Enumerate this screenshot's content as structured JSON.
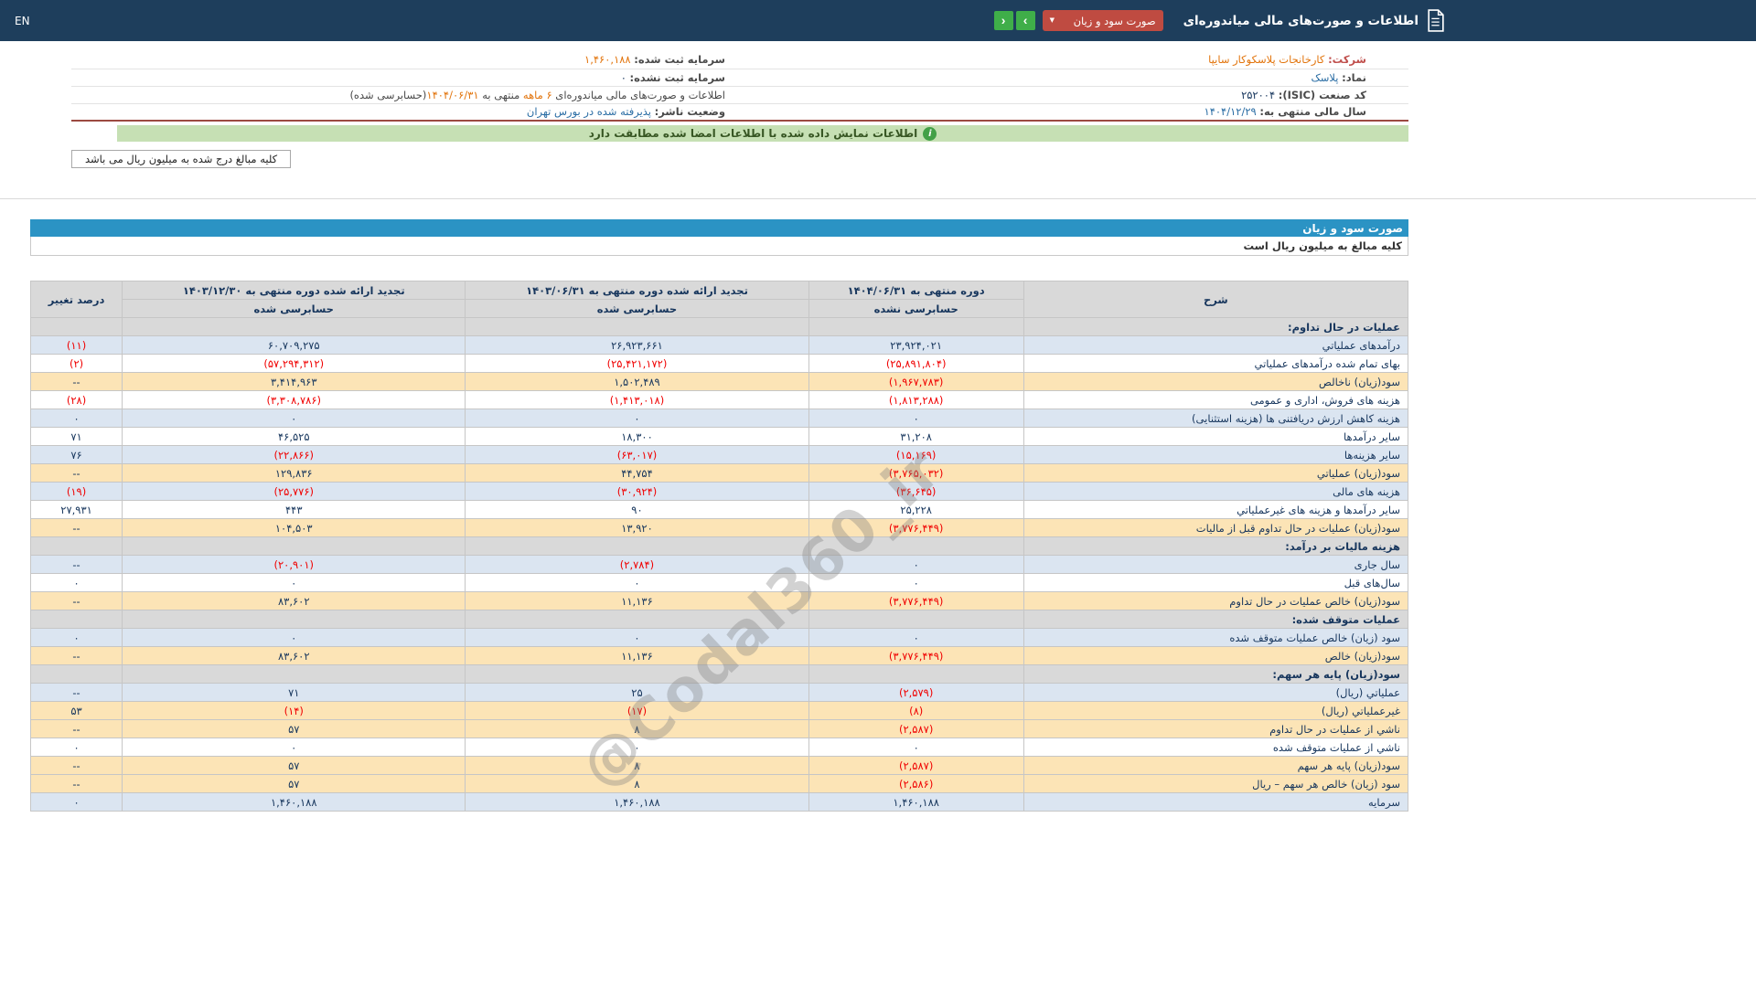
{
  "header": {
    "title": "اطلاعات و صورت‌های مالی میاندوره‌ای",
    "dropdown_value": "صورت سود و زیان",
    "next_label": "›",
    "prev_label": "‹",
    "en_label": "EN"
  },
  "company": {
    "name_label": "شرکت:",
    "name_value": "کارخانجات پلاسکوکار سایپا",
    "symbol_label": "نماد:",
    "symbol_value": "پلاسک",
    "isic_label": "کد صنعت (ISIC):",
    "isic_value": "۲۵۲۰۰۴",
    "fiscal_label": "سال مالی منتهی به:",
    "fiscal_value": "۱۴۰۴/۱۲/۲۹",
    "registered_capital_label": "سرمایه ثبت شده:",
    "registered_capital_value": "۱,۴۶۰,۱۸۸",
    "unregistered_capital_label": "سرمایه ثبت نشده:",
    "unregistered_capital_value": "۰",
    "period_info": {
      "p1": "اطلاعات و صورت‌های مالی میاندوره‌ای ",
      "p2": "۶ ماهه",
      "p3": " منتهی به ",
      "p4": "۱۴۰۴/۰۶/۳۱",
      "p5": "(حسابرسی شده)"
    },
    "issuer_status_label": "وضعیت ناشر:",
    "issuer_status_value": "پذیرفته شده در بورس تهران"
  },
  "notice": "اطلاعات نمایش داده شده با اطلاعات امضا شده مطابقت دارد",
  "amounts_note": "کلیه مبالغ درج شده به میلیون ریال می باشد",
  "watermark": "@Codal360_ir",
  "statement": {
    "title": "صورت سود و زیان",
    "unit_note": "کلیه مبالغ به میلیون ریال است",
    "table": {
      "desc_header": "شرح",
      "change_header": "درصد تغییر",
      "periods": [
        {
          "title": "دوره منتهی به ۱۴۰۴/۰۶/۳۱",
          "audit": "حسابرسی نشده"
        },
        {
          "title": "تجدید ارائه شده دوره منتهی به ۱۴۰۳/۰۶/۳۱",
          "audit": "حسابرسی شده"
        },
        {
          "title": "تجدید ارائه شده دوره منتهی به ۱۴۰۳/۱۲/۳۰",
          "audit": "حسابرسی شده"
        }
      ],
      "rows": [
        {
          "type": "section",
          "label": "عملیات در حال تداوم:"
        },
        {
          "type": "data",
          "label": "درآمدهای عملیاتي",
          "values": [
            "۲۳,۹۲۴,۰۲۱",
            "۲۶,۹۲۳,۶۶۱",
            "۶۰,۷۰۹,۲۷۵"
          ],
          "change": "(۱۱)"
        },
        {
          "type": "data",
          "label": "بهای تمام شده درآمدهای عملیاتي",
          "values": [
            "(۲۵,۸۹۱,۸۰۴)",
            "(۲۵,۴۲۱,۱۷۲)",
            "(۵۷,۲۹۴,۳۱۲)"
          ],
          "change": "(۲)"
        },
        {
          "type": "data",
          "total": true,
          "label": "سود(زیان) ناخالص",
          "values": [
            "(۱,۹۶۷,۷۸۳)",
            "۱,۵۰۲,۴۸۹",
            "۳,۴۱۴,۹۶۳"
          ],
          "change": "--"
        },
        {
          "type": "data",
          "label": "هزینه های فروش، اداری و عمومی",
          "values": [
            "(۱,۸۱۳,۲۸۸)",
            "(۱,۴۱۳,۰۱۸)",
            "(۳,۳۰۸,۷۸۶)"
          ],
          "change": "(۲۸)"
        },
        {
          "type": "data",
          "label": "هزینه کاهش ارزش دریافتنی ها (هزینه استثنایی)",
          "values": [
            "۰",
            "۰",
            "۰"
          ],
          "change": "۰"
        },
        {
          "type": "data",
          "label": "سایر درآمدها",
          "values": [
            "۳۱,۲۰۸",
            "۱۸,۳۰۰",
            "۴۶,۵۲۵"
          ],
          "change": "۷۱"
        },
        {
          "type": "data",
          "label": "سایر هزینه‌ها",
          "values": [
            "(۱۵,۱۶۹)",
            "(۶۳,۰۱۷)",
            "(۲۲,۸۶۶)"
          ],
          "change": "۷۶"
        },
        {
          "type": "data",
          "total": true,
          "label": "سود(زیان) عملیاتي",
          "values": [
            "(۳,۷۶۵,۰۳۲)",
            "۴۴,۷۵۴",
            "۱۲۹,۸۳۶"
          ],
          "change": "--"
        },
        {
          "type": "data",
          "label": "هزینه های مالی",
          "values": [
            "(۳۶,۶۴۵)",
            "(۳۰,۹۲۴)",
            "(۲۵,۷۷۶)"
          ],
          "change": "(۱۹)"
        },
        {
          "type": "data",
          "label": "سایر درآمدها و هزینه های غیرعملیاتي",
          "values": [
            "۲۵,۲۲۸",
            "۹۰",
            "۴۴۳"
          ],
          "change": "۲۷,۹۳۱"
        },
        {
          "type": "data",
          "total": true,
          "label": "سود(زیان) عملیات در حال تداوم قبل از مالیات",
          "values": [
            "(۳,۷۷۶,۴۴۹)",
            "۱۳,۹۲۰",
            "۱۰۴,۵۰۳"
          ],
          "change": "--"
        },
        {
          "type": "section",
          "label": "هزینه مالیات بر درآمد:"
        },
        {
          "type": "data",
          "label": "سال جاری",
          "values": [
            "۰",
            "(۲,۷۸۴)",
            "(۲۰,۹۰۱)"
          ],
          "change": "--"
        },
        {
          "type": "data",
          "label": "سال‌های قبل",
          "values": [
            "۰",
            "۰",
            "۰"
          ],
          "change": "۰"
        },
        {
          "type": "data",
          "total": true,
          "label": "سود(زیان) خالص عملیات در حال تداوم",
          "values": [
            "(۳,۷۷۶,۴۴۹)",
            "۱۱,۱۳۶",
            "۸۳,۶۰۲"
          ],
          "change": "--"
        },
        {
          "type": "section",
          "label": "عملیات متوقف شده:"
        },
        {
          "type": "data",
          "label": "سود (زیان) خالص عملیات متوقف شده",
          "values": [
            "۰",
            "۰",
            "۰"
          ],
          "change": "۰"
        },
        {
          "type": "data",
          "total": true,
          "label": "سود(زیان) خالص",
          "values": [
            "(۳,۷۷۶,۴۴۹)",
            "۱۱,۱۳۶",
            "۸۳,۶۰۲"
          ],
          "change": "--"
        },
        {
          "type": "section",
          "label": "سود(زیان) پایه هر سهم:"
        },
        {
          "type": "data",
          "label": "عملیاتي (ریال)",
          "values": [
            "(۲,۵۷۹)",
            "۲۵",
            "۷۱"
          ],
          "change": "--"
        },
        {
          "type": "data",
          "total": true,
          "label": "غیرعملیاتي (ریال)",
          "values": [
            "(۸)",
            "(۱۷)",
            "(۱۴)"
          ],
          "change": "۵۳"
        },
        {
          "type": "data",
          "total": true,
          "label": "ناشي از عملیات در حال تداوم",
          "values": [
            "(۲,۵۸۷)",
            "۸",
            "۵۷"
          ],
          "change": "--"
        },
        {
          "type": "data",
          "label": "ناشي از عملیات متوقف شده",
          "values": [
            "۰",
            "۰",
            "۰"
          ],
          "change": "۰"
        },
        {
          "type": "data",
          "total": true,
          "label": "سود(زیان) پایه هر سهم",
          "values": [
            "(۲,۵۸۷)",
            "۸",
            "۵۷"
          ],
          "change": "--"
        },
        {
          "type": "data",
          "total": true,
          "label": "سود (زیان) خالص هر سهم – ریال",
          "values": [
            "(۲,۵۸۶)",
            "۸",
            "۵۷"
          ],
          "change": "--"
        },
        {
          "type": "data",
          "label": "سرمایه",
          "values": [
            "۱,۴۶۰,۱۸۸",
            "۱,۴۶۰,۱۸۸",
            "۱,۴۶۰,۱۸۸"
          ],
          "change": "۰"
        }
      ]
    }
  }
}
